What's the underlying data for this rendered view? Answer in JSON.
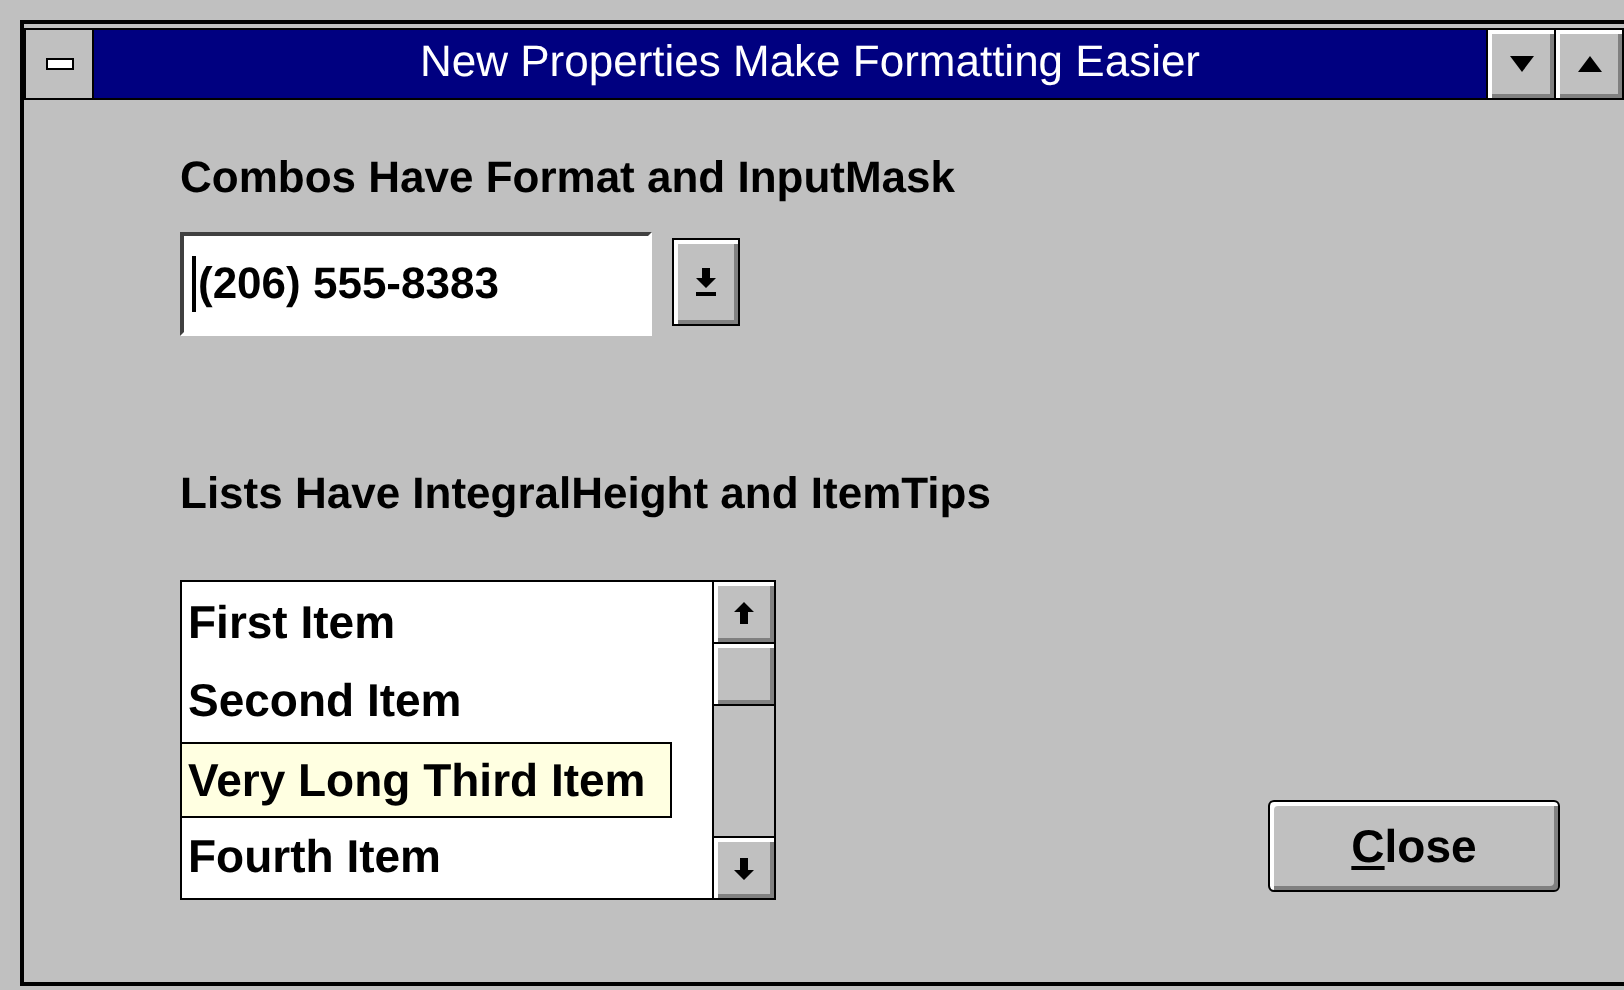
{
  "window": {
    "title": "New Properties Make Formatting Easier"
  },
  "combo_section": {
    "heading": "Combos Have Format and InputMask",
    "value": "(206) 555-8383"
  },
  "list_section": {
    "heading": "Lists Have IntegralHeight and ItemTips",
    "items": [
      {
        "text": "First Item",
        "tip_shown": false
      },
      {
        "text": "Second Item",
        "tip_shown": false
      },
      {
        "text": "Very Long Third Item",
        "tip_shown": true
      },
      {
        "text": "Fourth Item",
        "tip_shown": false
      }
    ]
  },
  "close_button": {
    "label_parts": [
      {
        "text": "C",
        "underlined": true
      },
      {
        "text": "lose",
        "underlined": false
      }
    ]
  }
}
